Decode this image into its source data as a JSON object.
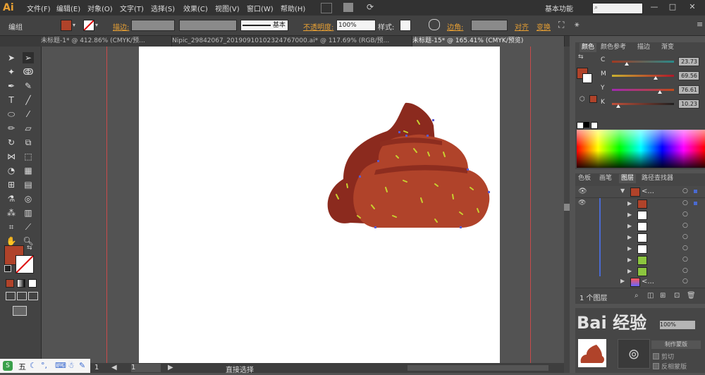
{
  "app": {
    "logo": "Ai",
    "workspace": "基本功能",
    "search_placeholder": ""
  },
  "menu": [
    "文件(F)",
    "编辑(E)",
    "对象(O)",
    "文字(T)",
    "选择(S)",
    "效果(C)",
    "视图(V)",
    "窗口(W)",
    "帮助(H)"
  ],
  "window_buttons": [
    "—",
    "□",
    "✕"
  ],
  "control_bar": {
    "mode": "编组",
    "stroke_label": "描边:",
    "stroke_style": "基本",
    "opacity_label": "不透明度:",
    "opacity_value": "100%",
    "style_label": "样式:",
    "corner_label": "边角:",
    "align_label": "对齐",
    "transform_label": "变换",
    "fill_color": "#b0432a"
  },
  "tabs": [
    {
      "label": "未标题-1* @ 412.86% (CMYK/预...",
      "active": false
    },
    {
      "label": "Nipic_29842067_20190910102324767000.ai* @ 117.69% (RGB/预...",
      "active": false
    },
    {
      "label": "未标题-15* @ 165.41% (CMYK/预览)",
      "active": true
    }
  ],
  "color_panel": {
    "tabs": [
      "颜色",
      "颜色参考",
      "描边",
      "渐变"
    ],
    "channels": [
      {
        "name": "C",
        "value": "23.73",
        "level": 0.24,
        "track": "linear-gradient(to right,#a03a22,#2a8a8a)"
      },
      {
        "name": "M",
        "value": "69.56",
        "level": 0.7,
        "track": "linear-gradient(to right,#c8b030,#b0182a)"
      },
      {
        "name": "Y",
        "value": "76.61",
        "level": 0.77,
        "track": "linear-gradient(to right,#a02ab0,#c04a1a)"
      },
      {
        "name": "K",
        "value": "10.23",
        "level": 0.1,
        "track": "linear-gradient(to right,#c0503a,#202020)"
      }
    ],
    "swatch_color": "#b0432a"
  },
  "layers_panel": {
    "tabs": [
      "色板",
      "画笔",
      "图层",
      "路径查找器"
    ],
    "layer_name": "<...",
    "sublayer_name": "<...",
    "footer": "1 个图层",
    "rows": [
      {
        "thumb": "#b0432a",
        "indent": 1
      },
      {
        "thumb": "#ffffff",
        "indent": 1
      },
      {
        "thumb": "#ffffff",
        "indent": 1
      },
      {
        "thumb": "#ffffff",
        "indent": 1
      },
      {
        "thumb": "#ffffff",
        "indent": 1
      },
      {
        "thumb": "#8cc63f",
        "indent": 1
      },
      {
        "thumb": "#8cc63f",
        "indent": 1
      }
    ]
  },
  "transparency_panel": {
    "value": "100%",
    "clip_label": "剪切",
    "invert_label": "反相蒙版",
    "make_mask_label": "制作蒙版"
  },
  "status_bar": {
    "zoom": "1",
    "page": "1",
    "tool": "直接选择"
  },
  "watermark": "Bai 经验",
  "taskbar": {
    "ime": "五"
  },
  "colors": {
    "poop_dark": "#8b2a1e",
    "poop_main": "#b0432a",
    "poop_band": "#8d2d1f",
    "sprinkle": "#c8d030",
    "anchor": "#5a5ad0"
  }
}
